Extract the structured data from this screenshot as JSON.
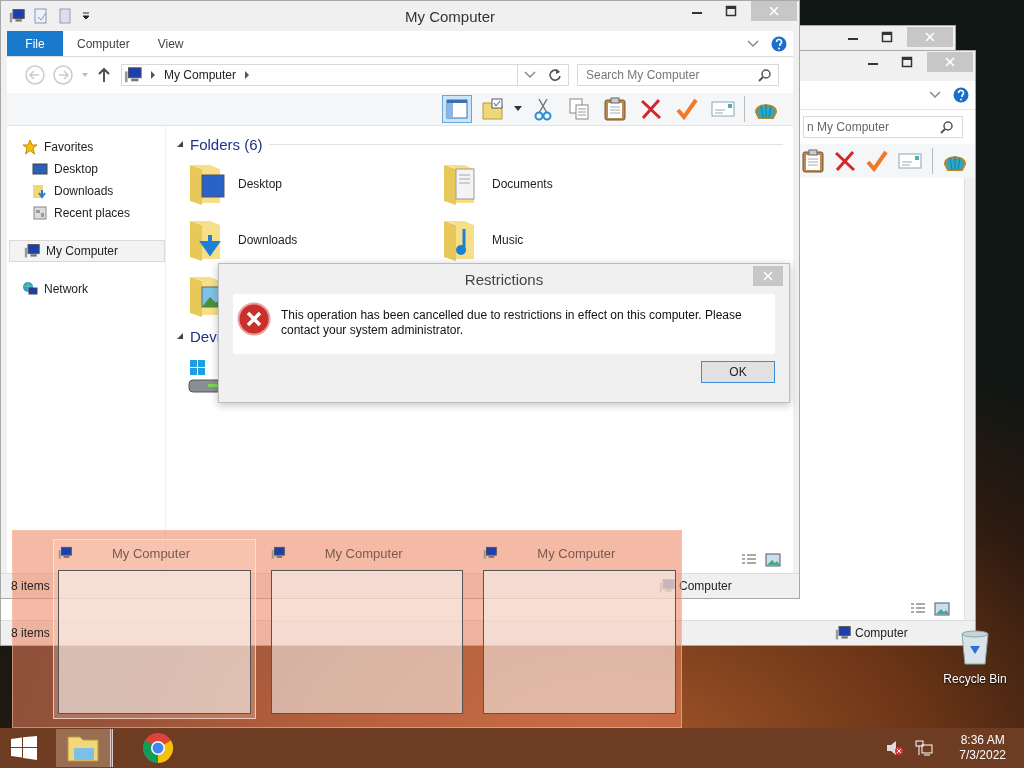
{
  "back_window": {
    "search_value": "n My Computer",
    "toolbar": [
      {
        "kind": "paste"
      },
      {
        "kind": "delete"
      },
      {
        "kind": "check"
      },
      {
        "kind": "envelope"
      },
      {
        "kind": "shell"
      }
    ],
    "status": {
      "count": "8 items",
      "location": "Computer"
    }
  },
  "main_window": {
    "title": "My Computer",
    "ribbon_tabs": [
      {
        "label": "File",
        "selected": true
      },
      {
        "label": "Computer",
        "selected": false
      },
      {
        "label": "View",
        "selected": false
      }
    ],
    "breadcrumb": [
      "My Computer"
    ],
    "search": {
      "placeholder": "Search My Computer"
    },
    "toolbar": [
      {
        "kind": "layout",
        "on": true
      },
      {
        "kind": "folder",
        "on": false
      },
      {
        "kind": "cut",
        "on": false
      },
      {
        "kind": "copy",
        "on": false
      },
      {
        "kind": "paste",
        "on": false
      },
      {
        "kind": "delete",
        "on": false
      },
      {
        "kind": "check",
        "on": false
      },
      {
        "kind": "envelope",
        "on": false
      },
      {
        "kind": "shell",
        "on": false
      }
    ],
    "sidebar": [
      {
        "label": "Favorites",
        "kind": "star",
        "selected": false,
        "children": [
          {
            "label": "Desktop",
            "kind": "desktop",
            "selected": false
          },
          {
            "label": "Downloads",
            "kind": "downloads",
            "selected": false
          },
          {
            "label": "Recent places",
            "kind": "recent",
            "selected": false
          }
        ]
      },
      {
        "label": "My Computer",
        "kind": "computer",
        "selected": true
      },
      {
        "label": "Network",
        "kind": "network",
        "selected": false
      }
    ],
    "groups": [
      {
        "title": "Folders (6)",
        "items": [
          {
            "label": "Desktop",
            "kind": "desktop"
          },
          {
            "label": "Documents",
            "kind": "documents"
          },
          {
            "label": "Downloads",
            "kind": "downloads"
          },
          {
            "label": "Music",
            "kind": "music"
          },
          {
            "kind": "pictures"
          }
        ]
      },
      {
        "title": "Devi",
        "items": [
          {
            "kind": "drive"
          }
        ]
      }
    ],
    "status": {
      "count": "8 items",
      "location": "Computer"
    }
  },
  "dialog": {
    "title": "Restrictions",
    "message": "This operation has been cancelled due to restrictions in effect on this computer. Please contact your system administrator.",
    "button": "OK"
  },
  "thumbnails": [
    {
      "title": "My Computer",
      "selected": true
    },
    {
      "title": "My Computer",
      "selected": false
    },
    {
      "title": "My Computer",
      "selected": false
    }
  ],
  "desktop_icons": [
    {
      "label": "Recycle Bin"
    }
  ],
  "taskbar": {
    "apps": [
      {
        "kind": "explorer",
        "selected": true
      },
      {
        "kind": "chrome",
        "selected": false
      }
    ],
    "clock": {
      "time": "8:36 AM",
      "date": "7/3/2022"
    }
  }
}
